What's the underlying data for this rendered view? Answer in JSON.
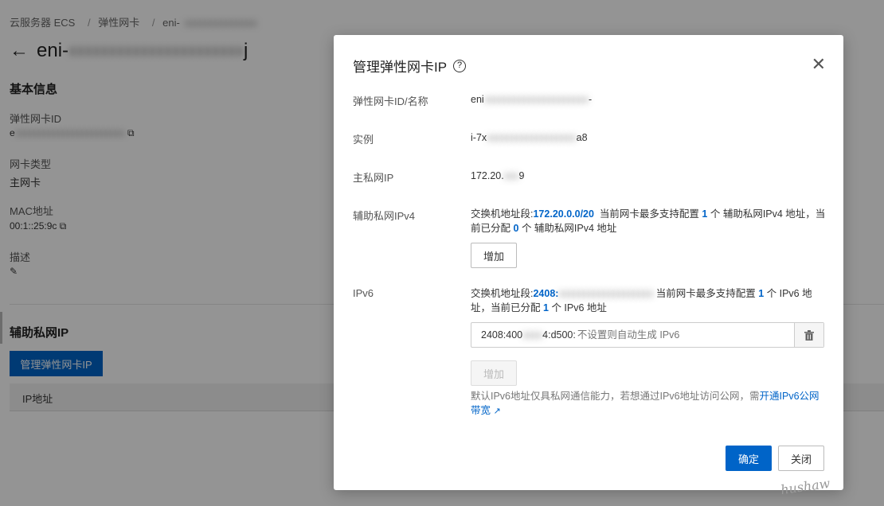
{
  "breadcrumb": {
    "items": [
      "云服务器 ECS",
      "弹性网卡",
      "eni-"
    ],
    "separator": "/"
  },
  "page": {
    "title": "eni-",
    "title_suffix": "j"
  },
  "basic_info": {
    "section_title": "基本信息",
    "eni_id_label": "弹性网卡ID",
    "eni_id_value": "e",
    "nic_type_label": "网卡类型",
    "nic_type_value": "主网卡",
    "mac_label": "MAC地址",
    "mac_value": "00:1::25:9c",
    "desc_label": "描述"
  },
  "secondary_ip": {
    "section_title": "辅助私网IP",
    "manage_button": "管理弹性网卡IP",
    "table_header_ip": "IP地址"
  },
  "modal": {
    "title": "管理弹性网卡IP",
    "eni_label": "弹性网卡ID/名称",
    "eni_value_prefix": "eni",
    "eni_value_suffix": "-",
    "instance_label": "实例",
    "instance_value_prefix": "i-7x",
    "instance_value_suffix": "a8",
    "primary_ip_label": "主私网IP",
    "primary_ip_value_prefix": "172.20.",
    "primary_ip_value_suffix": "9",
    "ipv4": {
      "label": "辅助私网IPv4",
      "segment_text": "交换机地址段:",
      "segment_value": "172.20.0.0/20",
      "max_text_1": "当前网卡最多支持配置",
      "max_count": "1",
      "max_text_2": "个 辅助私网IPv4 地址，当前已分配",
      "assigned_count": "0",
      "assigned_text": "个 辅助私网IPv4 地址",
      "add_button": "增加"
    },
    "ipv6": {
      "label": "IPv6",
      "segment_text": "交换机地址段:",
      "segment_value": "2408:",
      "max_text_1": "当前网卡最多支持配置",
      "max_count": "1",
      "max_text_2": "个 IPv6 地址，当前已分配",
      "assigned_count": "1",
      "assigned_text": "个 IPv6 地址",
      "input_prefix": "2408:400",
      "input_prefix_suffix": "4:d500:",
      "input_placeholder": "不设置则自动生成 IPv6",
      "add_button": "增加",
      "hint_text": "默认IPv6地址仅具私网通信能力，若想通过IPv6地址访问公网，需",
      "hint_link": "开通IPv6公网带宽"
    },
    "confirm_button": "确定",
    "close_button": "关闭"
  },
  "watermark": "hushaw"
}
